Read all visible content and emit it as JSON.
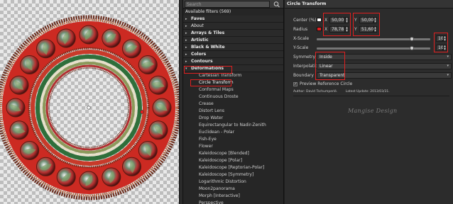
{
  "search": {
    "placeholder": "Search"
  },
  "filters": {
    "title": "Available filters (569)",
    "categories": [
      {
        "label": "Faves",
        "italic": false
      },
      {
        "label": "About",
        "italic": true
      },
      {
        "label": "Arrays & Tiles",
        "italic": false
      },
      {
        "label": "Artistic",
        "italic": false
      },
      {
        "label": "Black & White",
        "italic": false
      },
      {
        "label": "Colors",
        "italic": false
      },
      {
        "label": "Contours",
        "italic": false
      },
      {
        "label": "Deformations",
        "italic": false
      }
    ],
    "open_arrow": "▾",
    "closed_arrow": "▸",
    "items": [
      "Cartesian Transform",
      "Circle Transform",
      "Conformal Maps",
      "Continuous Droste",
      "Crease",
      "Distort Lens",
      "Drop Water",
      "Equirectangular to Nadir-Zenith",
      "Euclidean - Polar",
      "Fish-Eye",
      "Flower",
      "Kaleidoscope [Blended]",
      "Kaleidoscope [Polar]",
      "Kaleidoscope [Reptorian-Polar]",
      "Kaleidoscope [Symmetry]",
      "Logarithmic Distortion",
      "Moon2panorama",
      "Morph [Interactive]",
      "Perspective"
    ],
    "selected_item": "Circle Transform"
  },
  "settings": {
    "title": "Circle Transform",
    "center": {
      "label": "Center (%)",
      "x_label": "X",
      "y_label": "Y",
      "x": "50,00",
      "y": "50,00",
      "color": "#ffffff"
    },
    "radius": {
      "label": "Radius",
      "x_label": "X",
      "y_label": "Y",
      "x": "78,78",
      "y": "51,60",
      "color": "#e02020"
    },
    "x_scale": {
      "label": "X-Scale",
      "value": "10",
      "fraction": 0.84
    },
    "y_scale": {
      "label": "Y-Scale",
      "value": "10",
      "fraction": 0.84
    },
    "symmetry": {
      "label": "Symmetry",
      "value": "Inside"
    },
    "interpolation": {
      "label": "Interpolation",
      "value": "Linear"
    },
    "boundary": {
      "label": "Boundary",
      "value": "Transparent"
    },
    "preview": {
      "label": "Preview Reference Circle",
      "checked": true,
      "check_glyph": "✓"
    },
    "author": "Author: David Tschumperlé.",
    "latest_update": "Latest Update: 2013/03/31."
  },
  "watermark": "Mangise Design",
  "icons": {
    "search": "search-icon",
    "spin_up": "▲",
    "spin_down": "▼",
    "caret": "▾"
  },
  "colors": {
    "highlight": "#e02020",
    "ring_red": "#cc2a22"
  }
}
